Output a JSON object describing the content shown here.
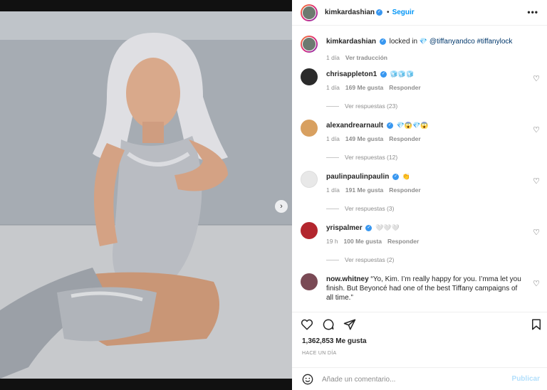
{
  "post": {
    "username": "kimkardashian",
    "follow_label": "Seguir",
    "more_label": "•••",
    "caption_text": "locked in",
    "caption_mention": "@tiffanyandco",
    "caption_hashtag": "#tiffanylock",
    "caption_time": "1 día",
    "caption_translate": "Ver traducción"
  },
  "comments": [
    {
      "user": "chrisappleton1",
      "text": "🧊🧊🧊",
      "time": "1 día",
      "likes": "169 Me gusta",
      "reply": "Responder",
      "replies": "Ver respuestas (23)"
    },
    {
      "user": "alexandrearnault",
      "text": "💎😱💎😱",
      "time": "1 día",
      "likes": "149 Me gusta",
      "reply": "Responder",
      "replies": "Ver respuestas (12)"
    },
    {
      "user": "paulinpaulinpaulin",
      "text": "👏",
      "time": "1 día",
      "likes": "191 Me gusta",
      "reply": "Responder",
      "replies": "Ver respuestas (3)"
    },
    {
      "user": "yrispalmer",
      "text": "🤍🤍🤍",
      "time": "19 h",
      "likes": "100 Me gusta",
      "reply": "Responder",
      "replies": "Ver respuestas (2)"
    },
    {
      "user": "now.whitney",
      "text": "“Yo, Kim. I’m really happy for you. I’mma let you finish. But Beyoncé had one of the best Tiffany campaigns of all time.”"
    }
  ],
  "engagement": {
    "likes": "1,362,853 Me gusta",
    "date": "HACE UN DÍA"
  },
  "comment_input": {
    "placeholder": "Añade un comentario...",
    "publish_label": "Publicar"
  },
  "colors": {
    "accent": "#0095f6",
    "verified": "#3897f0",
    "muted": "#8e8e8e"
  }
}
